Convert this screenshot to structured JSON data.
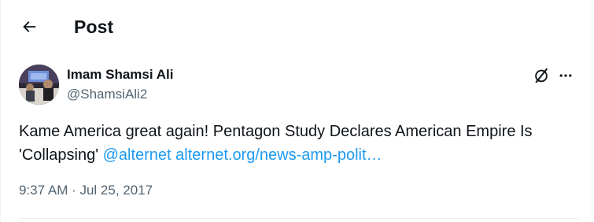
{
  "header": {
    "title": "Post",
    "back_icon": "arrow-left-icon"
  },
  "author": {
    "name": "Imam Shamsi Ali",
    "handle": "@ShamsiAli2",
    "avatar_icon": "avatar-photo"
  },
  "actions": {
    "grok_icon": "grok-slash-icon",
    "more_icon": "more-horizontal-icon"
  },
  "tweet": {
    "text": "Kame America great again! Pentagon Study Declares American Empire Is 'Collapsing'",
    "mention": "@alternet",
    "link": "alternet.org/news-amp-polit…"
  },
  "meta": {
    "timestamp": "9:37 AM · Jul 25, 2017"
  },
  "colors": {
    "text": "#0f1419",
    "secondary": "#536471",
    "link": "#1d9bf0",
    "border": "#eff3f4"
  }
}
